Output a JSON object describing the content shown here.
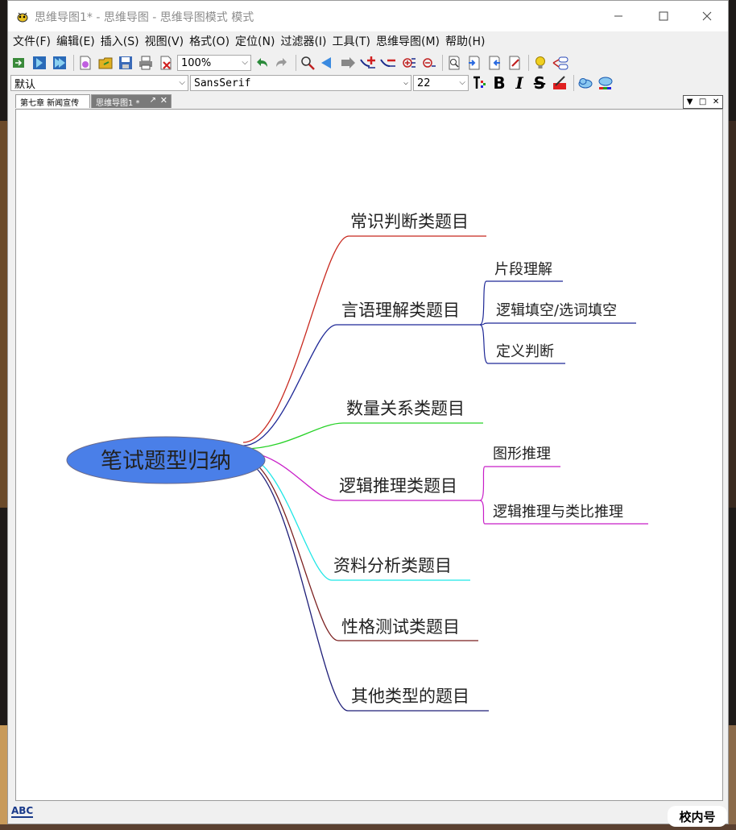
{
  "window": {
    "title": "思维导图1* - 思维导图 - 思维导图模式 模式"
  },
  "menu": [
    "文件(F)",
    "编辑(E)",
    "插入(S)",
    "视图(V)",
    "格式(O)",
    "定位(N)",
    "过滤器(I)",
    "工具(T)",
    "思维导图(M)",
    "帮助(H)"
  ],
  "toolbar": {
    "zoom": "100%",
    "style": "默认",
    "font": "SansSerif",
    "font_size": "22",
    "bold_label": "B",
    "italic_label": "I",
    "strike_label": "S"
  },
  "tabs": [
    {
      "label": "第七章 新闻宣传"
    },
    {
      "label": "思维导图1 *"
    }
  ],
  "mindmap": {
    "root": {
      "label": "笔试题型归纳",
      "fill": "#4a7fe8"
    },
    "branches": [
      {
        "label": "常识判断类题目",
        "color": "#c8281e",
        "children": []
      },
      {
        "label": "言语理解类题目",
        "color": "#1e2896",
        "children": [
          "片段理解",
          "逻辑填空/选词填空",
          "定义判断"
        ]
      },
      {
        "label": "数量关系类题目",
        "color": "#28d228",
        "children": []
      },
      {
        "label": "逻辑推理类题目",
        "color": "#c81ec8",
        "children": [
          "图形推理",
          "逻辑推理与类比推理"
        ]
      },
      {
        "label": "资料分析类题目",
        "color": "#1ee6e6",
        "children": []
      },
      {
        "label": "性格测试类题目",
        "color": "#7a1e1e",
        "children": []
      },
      {
        "label": "其他类型的题目",
        "color": "#1e1e78",
        "children": []
      }
    ]
  },
  "status": {
    "spell_label": "ABC"
  },
  "watermark": "校内号"
}
